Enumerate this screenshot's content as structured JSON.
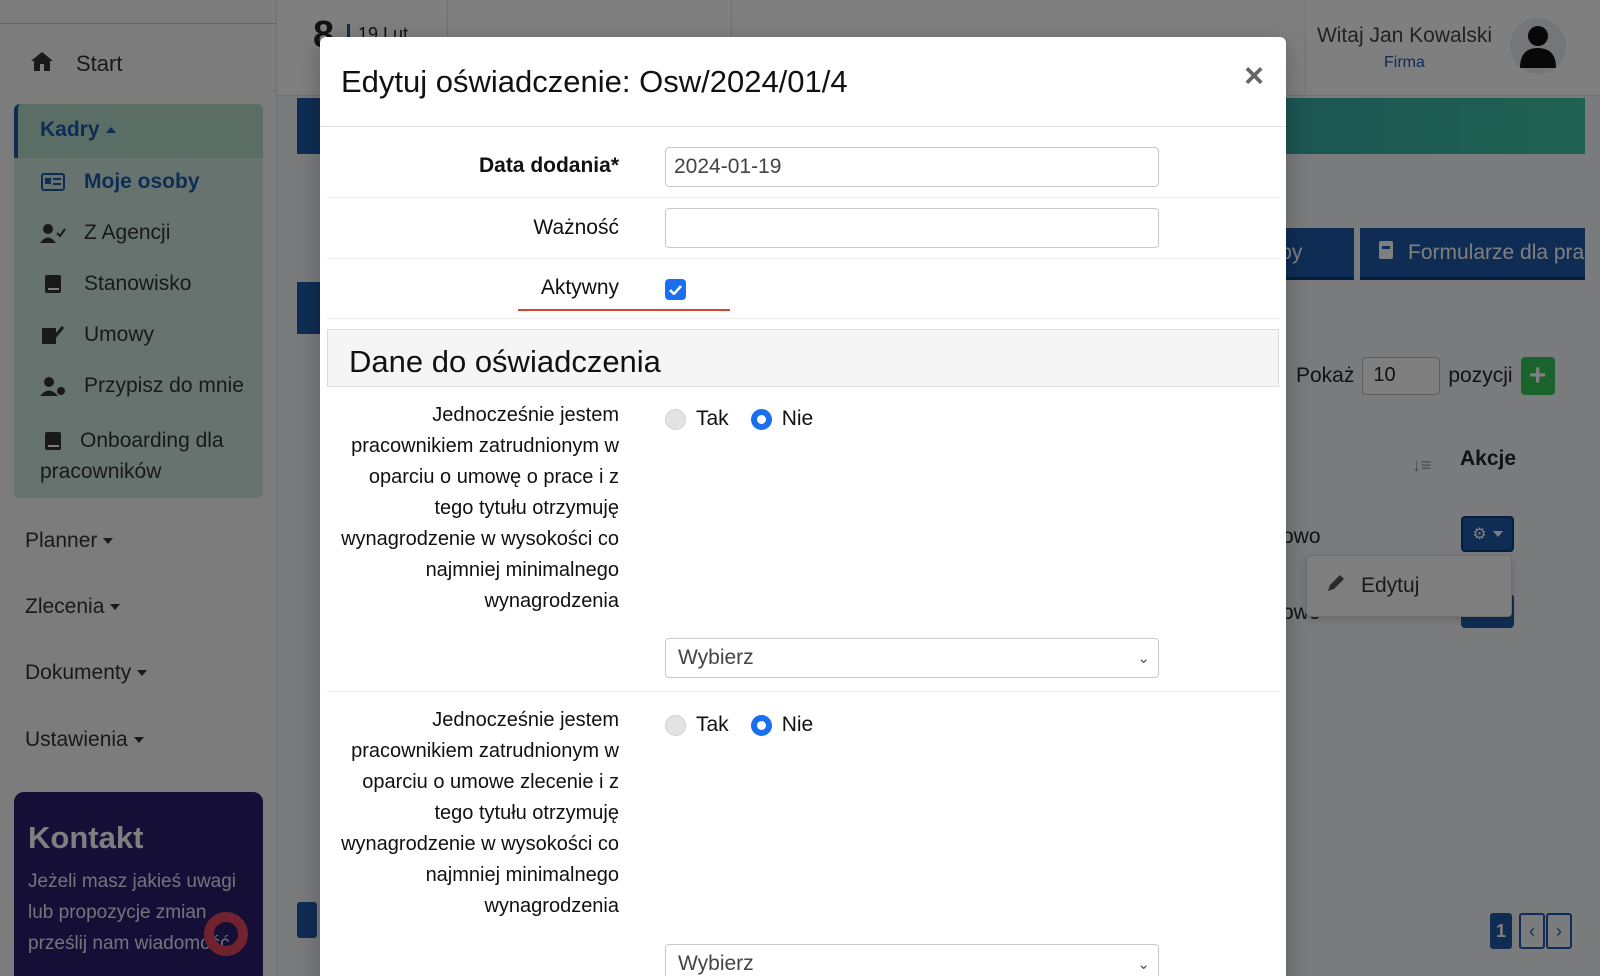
{
  "sidebar": {
    "start_label": "Start",
    "kadry_label": "Kadry",
    "kadry_items": [
      {
        "label": "Moje osoby",
        "icon": "id-card-icon"
      },
      {
        "label": "Z Agencji",
        "icon": "user-check-icon"
      },
      {
        "label": "Stanowisko",
        "icon": "book-icon"
      },
      {
        "label": "Umowy",
        "icon": "signature-icon"
      },
      {
        "label": "Przypisz do mnie",
        "icon": "user-cog-icon"
      },
      {
        "label": "Onboarding dla pracowników",
        "icon": "book-icon"
      }
    ],
    "menus": [
      "Planner",
      "Zlecenia",
      "Dokumenty",
      "Ustawienia"
    ],
    "kontakt": {
      "title": "Kontakt",
      "text": "Jeżeli masz jakieś uwagi lub propozycje zmian prześlij nam wiadomość"
    }
  },
  "topbar": {
    "day_number": "8",
    "date_small": "19 Lut",
    "greeting": "Witaj Jan Kowalski",
    "company": "Firma"
  },
  "page": {
    "tab_osoby_partial": "soby",
    "tab_formularze": "Formularze dla pra",
    "show_label": "Pokaż",
    "show_value": "10",
    "positions_label": "pozycji",
    "actions_header": "Akcje",
    "row1_text": "owo",
    "row2_text": "owo",
    "dropdown_edit": "Edytuj",
    "pager_current": "1"
  },
  "modal": {
    "title": "Edytuj oświadczenie: Osw/2024/01/4",
    "fields": {
      "date_label": "Data dodania*",
      "date_value": "2024-01-19",
      "validity_label": "Ważność",
      "validity_value": "",
      "active_label": "Aktywny",
      "active_checked": true
    },
    "section_title": "Dane do oświadczenia",
    "questions": [
      {
        "text": "Jednocześnie jestem pracownikiem zatrudnionym w oparciu o umowę o prace i z tego tytułu otrzymuję wynagrodzenie w wysokości co najmniej minimalnego wynagrodzenia",
        "yes": "Tak",
        "no": "Nie",
        "selected": "Nie",
        "select_value": "Wybierz"
      },
      {
        "text": "Jednocześnie jestem pracownikiem zatrudnionym w oparciu o umowe zlecenie i z tego tytułu otrzymuję wynagrodzenie w wysokości co najmniej minimalnego wynagrodzenia",
        "yes": "Tak",
        "no": "Nie",
        "selected": "Nie",
        "select_value": "Wybierz"
      }
    ]
  },
  "colors": {
    "primary": "#1e5aa8",
    "accent_green": "#3fc4a3",
    "checkbox_blue": "#1a6ff0",
    "kontakt_bg": "#2b1d6e"
  }
}
